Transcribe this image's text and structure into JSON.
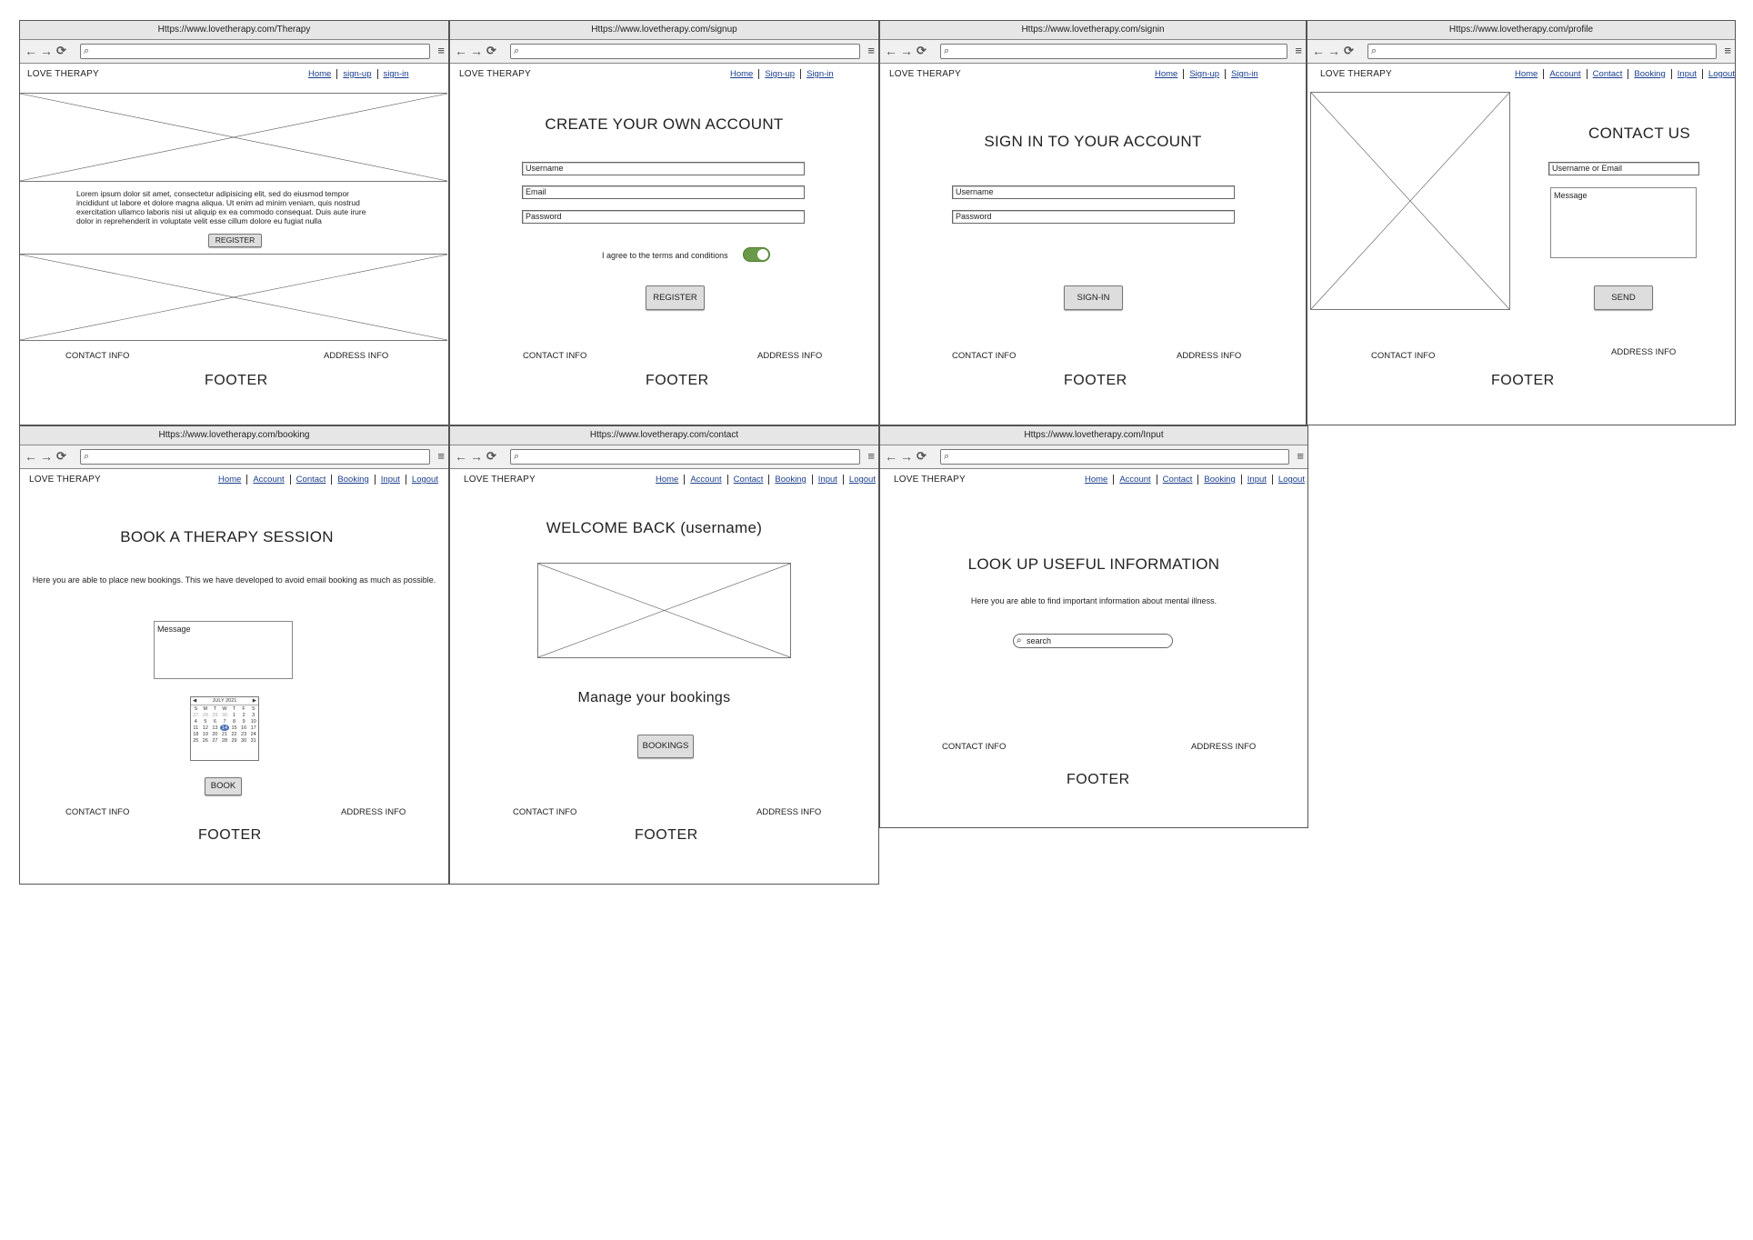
{
  "common": {
    "brand": "LOVE THERAPY",
    "contact_info": "CONTACT INFO",
    "address_info": "ADDRESS INFO",
    "footer": "FOOTER",
    "nav_back": "←",
    "nav_forward": "→",
    "nav_reload": "⟳",
    "search_glyph": "⌕",
    "menu_glyph": "≡"
  },
  "therapy": {
    "url": "Https://www.lovetherapy.com/Therapy",
    "nav": [
      "Home",
      "sign-up",
      "sign-in"
    ],
    "paragraph": "Lorem ipsum dolor sit amet, consectetur adipisicing elit, sed do eiusmod tempor incididunt ut labore et dolore magna aliqua. Ut enim ad minim veniam, quis nostrud exercitation ullamco laboris nisi ut aliquip ex ea commodo consequat. Duis aute irure dolor in reprehenderit in voluptate velit esse cillum dolore eu fugiat nulla",
    "register": "REGISTER"
  },
  "signup": {
    "url": "Https://www.lovetherapy.com/signup",
    "nav": [
      "Home",
      "Sign-up",
      "Sign-in"
    ],
    "heading": "CREATE YOUR OWN ACCOUNT",
    "username": "Username",
    "email": "Email",
    "password": "Password",
    "terms": "I agree to the terms and conditions",
    "register": "REGISTER"
  },
  "signin": {
    "url": "Https://www.lovetherapy.com/signin",
    "nav": [
      "Home",
      "Sign-up",
      "Sign-in"
    ],
    "heading": "SIGN IN TO YOUR ACCOUNT",
    "username": "Username",
    "password": "Password",
    "button": "SIGN-IN"
  },
  "profile": {
    "url": "Https://www.lovetherapy.com/profile",
    "nav": [
      "Home",
      "Account",
      "Contact",
      "Booking",
      "Input",
      "Logout"
    ],
    "heading": "CONTACT US",
    "user_or_email": "Username or Email",
    "message": "Message",
    "send": "SEND"
  },
  "booking": {
    "url": "Https://www.lovetherapy.com/booking",
    "nav": [
      "Home",
      "Account",
      "Contact",
      "Booking",
      "Input",
      "Logout"
    ],
    "heading": "BOOK A THERAPY SESSION",
    "text": "Here you are able to place new bookings. This we have developed to avoid email booking as much as possible.",
    "message": "Message",
    "calendar": {
      "month": "JULY 2021",
      "prev": "◀",
      "next": "▶",
      "days": [
        "S",
        "M",
        "T",
        "W",
        "T",
        "F",
        "S"
      ],
      "weeks": [
        [
          "27",
          "28",
          "29",
          "30",
          "1",
          "2",
          "3"
        ],
        [
          "4",
          "5",
          "6",
          "7",
          "8",
          "9",
          "10"
        ],
        [
          "11",
          "12",
          "13",
          "14",
          "15",
          "16",
          "17"
        ],
        [
          "18",
          "19",
          "20",
          "21",
          "22",
          "23",
          "24"
        ],
        [
          "25",
          "26",
          "27",
          "28",
          "29",
          "30",
          "31"
        ],
        [
          "",
          "",
          "",
          "",
          "",
          "",
          ""
        ]
      ],
      "selected": "14"
    },
    "book": "BOOK"
  },
  "contact": {
    "url": "Https://www.lovetherapy.com/contact",
    "nav": [
      "Home",
      "Account",
      "Contact",
      "Booking",
      "Input",
      "Logout"
    ],
    "heading": "WELCOME BACK (username)",
    "subheading": "Manage your bookings",
    "button": "BOOKINGS"
  },
  "input": {
    "url": "Https://www.lovetherapy.com/Input",
    "nav": [
      "Home",
      "Account",
      "Contact",
      "Booking",
      "Input",
      "Logout"
    ],
    "heading": "LOOK UP USEFUL INFORMATION",
    "text": "Here you are able to find important information about mental illness.",
    "search_placeholder": "search"
  }
}
